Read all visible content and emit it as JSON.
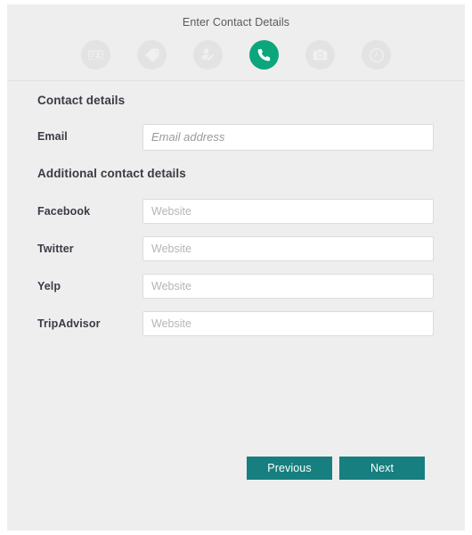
{
  "header": {
    "title": "Enter Contact Details",
    "active_step_index": 3,
    "active_color": "#0ca67c",
    "inactive_color": "#e3e3e3",
    "steps": [
      {
        "icon": "contact-card-icon",
        "label": "Contact Card",
        "active": false
      },
      {
        "icon": "tag-icon",
        "label": "Tag",
        "active": false
      },
      {
        "icon": "edit-person-icon",
        "label": "Edit Person",
        "active": false
      },
      {
        "icon": "phone-icon",
        "label": "Contact Details",
        "active": true
      },
      {
        "icon": "camera-icon",
        "label": "Photos",
        "active": false
      },
      {
        "icon": "clock-icon",
        "label": "Hours",
        "active": false
      }
    ]
  },
  "sections": [
    {
      "heading": "Contact details",
      "fields": [
        {
          "label": "Email",
          "placeholder": "Email address",
          "value": "",
          "style": "email"
        }
      ]
    },
    {
      "heading": "Additional contact details",
      "fields": [
        {
          "label": "Facebook",
          "placeholder": "Website",
          "value": "",
          "style": "website"
        },
        {
          "label": "Twitter",
          "placeholder": "Website",
          "value": "",
          "style": "website"
        },
        {
          "label": "Yelp",
          "placeholder": "Website",
          "value": "",
          "style": "website"
        },
        {
          "label": "TripAdvisor",
          "placeholder": "Website",
          "value": "",
          "style": "website"
        }
      ]
    }
  ],
  "footer": {
    "previous_label": "Previous",
    "next_label": "Next",
    "button_color": "#177f7f"
  }
}
